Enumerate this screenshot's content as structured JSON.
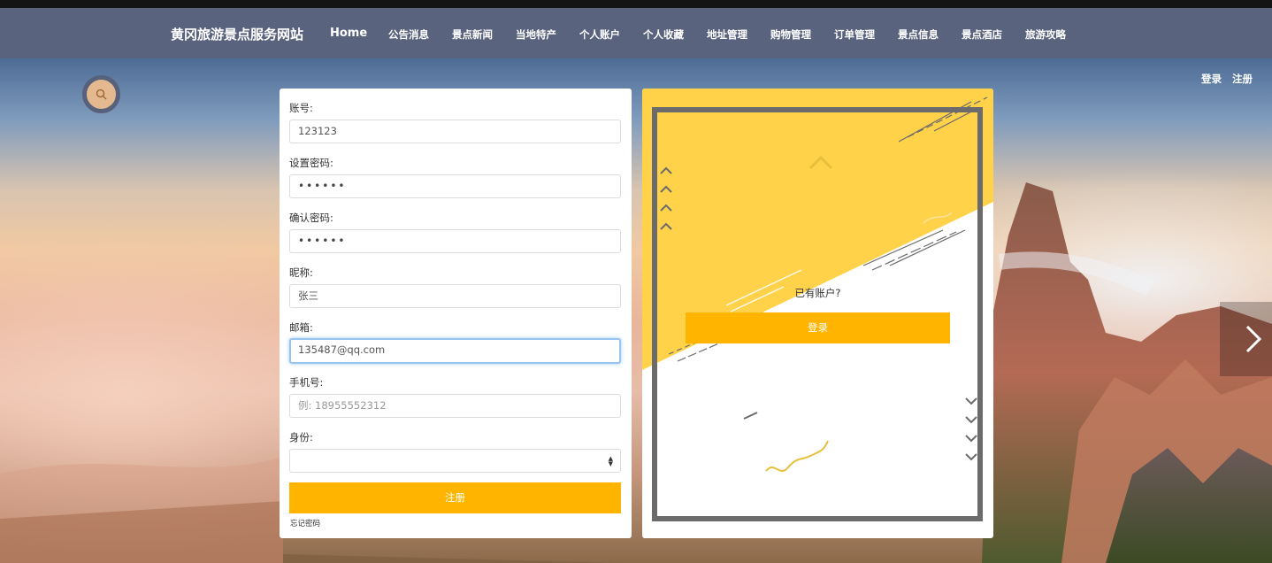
{
  "site": {
    "brand": "黄冈旅游景点服务网站",
    "nav": {
      "home": "Home",
      "items": [
        "公告消息",
        "景点新闻",
        "当地特产",
        "个人账户",
        "个人收藏",
        "地址管理",
        "购物管理",
        "订单管理",
        "景点信息",
        "景点酒店",
        "旅游攻略"
      ]
    },
    "auth": {
      "login": "登录",
      "register": "注册"
    }
  },
  "form": {
    "account_label": "账号:",
    "account_value": "123123",
    "password_label": "设置密码:",
    "password_value": "••••••",
    "confirm_label": "确认密码:",
    "confirm_value": "••••••",
    "nickname_label": "昵称:",
    "nickname_value": "张三",
    "email_label": "邮箱:",
    "email_value": "135487@qq.com",
    "phone_label": "手机号:",
    "phone_placeholder": "例: 18955552312",
    "identity_label": "身份:",
    "identity_value": "",
    "submit_label": "注册",
    "forgot_label": "忘记密码"
  },
  "side_panel": {
    "have_account_text": "已有账户?",
    "login_button": "登录"
  },
  "colors": {
    "navbar": "#59637d",
    "accent": "#ffb400",
    "panel_yellow": "#ffd24a"
  },
  "icons": {
    "search": "search-icon",
    "next": "chevron-right-icon"
  }
}
